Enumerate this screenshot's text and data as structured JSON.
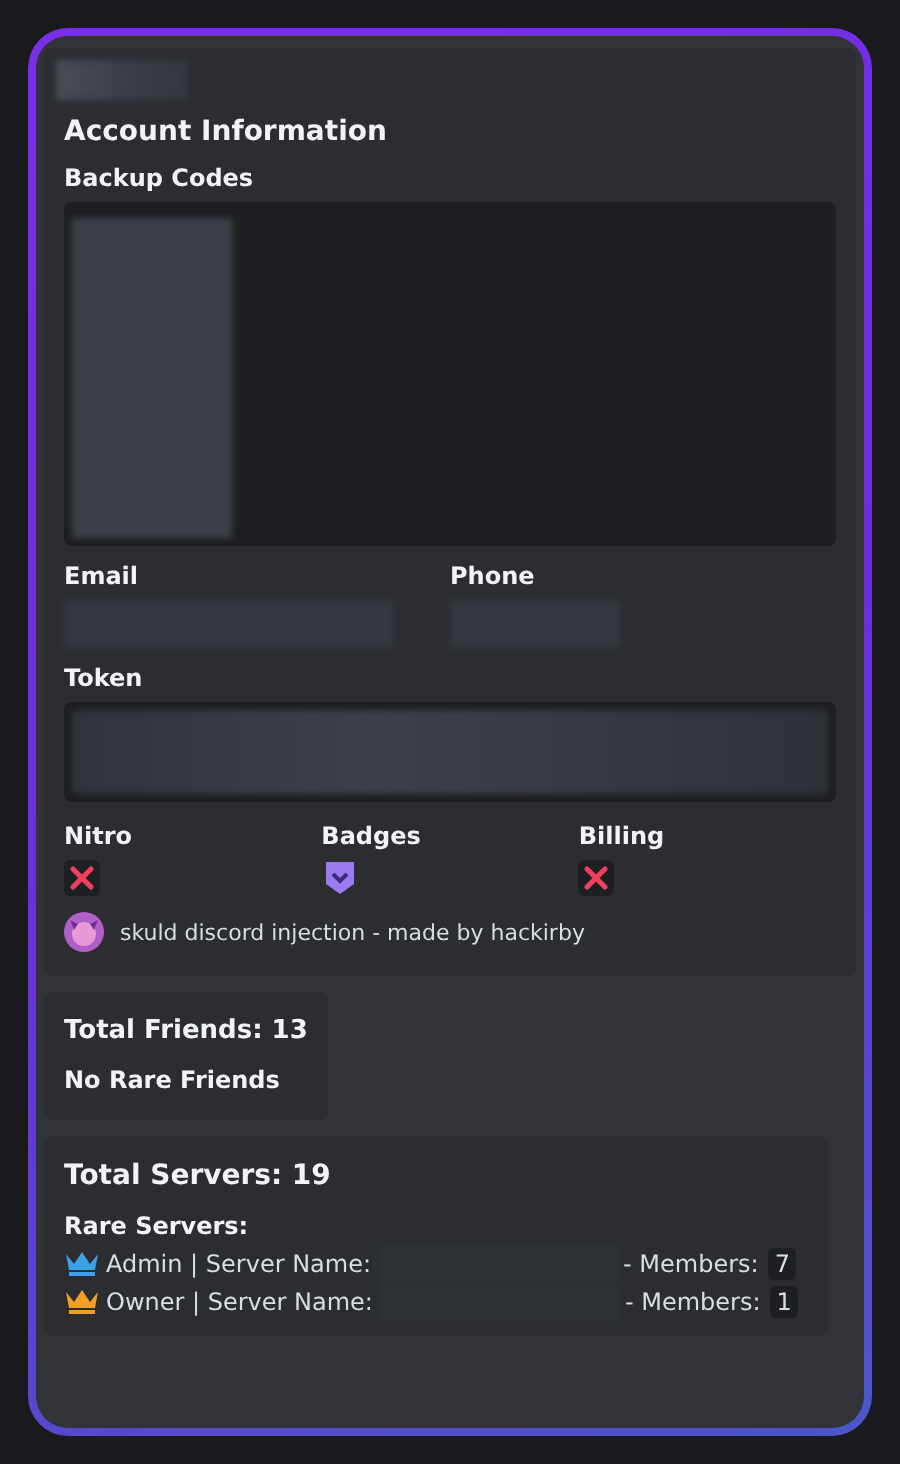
{
  "account": {
    "title": "Account Information",
    "backup_codes_label": "Backup Codes",
    "email_label": "Email",
    "phone_label": "Phone",
    "token_label": "Token"
  },
  "flags": [
    {
      "label": "Nitro",
      "kind": "cross"
    },
    {
      "label": "Badges",
      "kind": "badge"
    },
    {
      "label": "Billing",
      "kind": "cross"
    }
  ],
  "footer": {
    "text": "skuld discord injection - made by hackirby"
  },
  "friends": {
    "title": "Total Friends: 13",
    "rare": "No Rare Friends"
  },
  "servers": {
    "title": "Total Servers: 19",
    "rare_label": "Rare Servers:",
    "rows": [
      {
        "color": "#3aa0e8",
        "label": "Admin | Server Name:",
        "members_label": "- Members:",
        "members": "7"
      },
      {
        "color": "#f0a020",
        "label": "Owner | Server Name:",
        "members_label": "- Members:",
        "members": "1"
      }
    ]
  }
}
